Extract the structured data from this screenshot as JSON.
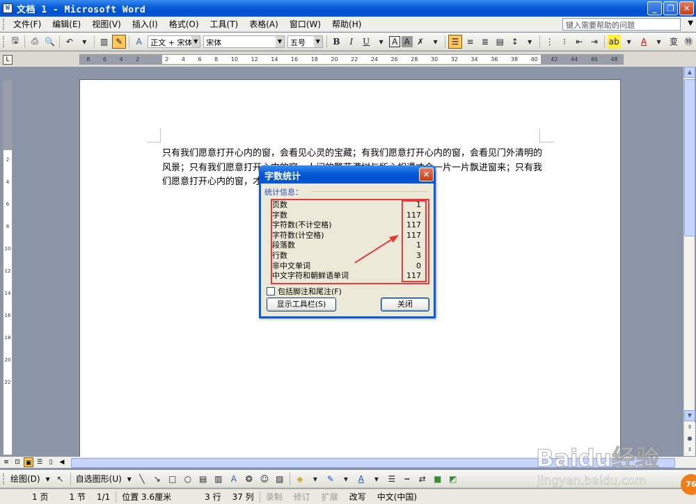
{
  "window": {
    "title": "文档 1 - Microsoft Word",
    "icon": "word-doc-icon"
  },
  "menu": {
    "items": [
      "文件(F)",
      "编辑(E)",
      "视图(V)",
      "插入(I)",
      "格式(O)",
      "工具(T)",
      "表格(A)",
      "窗口(W)",
      "帮助(H)"
    ],
    "help_placeholder": "键入需要帮助的问题"
  },
  "toolbar": {
    "style_value": "正文 + 宋体",
    "font_value": "宋体",
    "size_value": "五号",
    "bold": "B",
    "italic": "I",
    "underline": "U",
    "char_border": "A",
    "char_shade": "A",
    "phonetic": "变"
  },
  "ruler": {
    "h_numbers": [
      "8",
      "6",
      "4",
      "2",
      "",
      "2",
      "4",
      "6",
      "8",
      "10",
      "12",
      "14",
      "16",
      "18",
      "20",
      "22",
      "24",
      "26",
      "28",
      "30",
      "32",
      "34",
      "36",
      "38",
      "40",
      "42",
      "44",
      "46",
      "48"
    ],
    "v_numbers": [
      "2",
      "4",
      "6",
      "8",
      "10",
      "12",
      "14",
      "16",
      "18",
      "20",
      "22"
    ],
    "corner": "L"
  },
  "document": {
    "text": "只有我们愿意打开心内的窗，会看见心灵的宝藏；有我们愿意打开心内的窗，会看见门外清明的风景；只有我们愿意打开心内的窗，人间的繁花满树与所心相遇才会一片一片飘进窗来；只有我们愿意打开心内的窗，才会把阳光和爱迎进来，照向光明的所在。↵"
  },
  "dialog": {
    "title": "字数统计",
    "group_label": "统计信息：",
    "stats": [
      {
        "label": "页数",
        "value": "1"
      },
      {
        "label": "字数",
        "value": "117"
      },
      {
        "label": "字符数(不计空格)",
        "value": "117"
      },
      {
        "label": "字符数(计空格)",
        "value": "117"
      },
      {
        "label": "段落数",
        "value": "1"
      },
      {
        "label": "行数",
        "value": "3"
      },
      {
        "label": "非中文单词",
        "value": "0"
      },
      {
        "label": "中文字符和朝鲜语单词",
        "value": "117"
      }
    ],
    "checkbox_label": "包括脚注和尾注(F)",
    "show_toolbar_button": "显示工具栏(S)",
    "close_button": "关闭",
    "highlight_color": "#e83a3a"
  },
  "drawbar": {
    "draw_label": "绘图(D)",
    "autoshapes_label": "自选图形(U)"
  },
  "status": {
    "page": "1 页",
    "section": "1 节",
    "page_of": "1/1",
    "position": "位置 3.6厘米",
    "line": "3 行",
    "column": "37 列",
    "rec": "录制",
    "trk": "修订",
    "ext": "扩展",
    "ovr": "改写",
    "language": "中文(中国)"
  },
  "watermark": {
    "logo": "Baidu经验",
    "url": "jingyan.baidu.com",
    "badge": "76"
  },
  "colors": {
    "titlebar": "#0a5fd8",
    "arrow": "#e83a3a",
    "workspace": "#8c95a8"
  }
}
